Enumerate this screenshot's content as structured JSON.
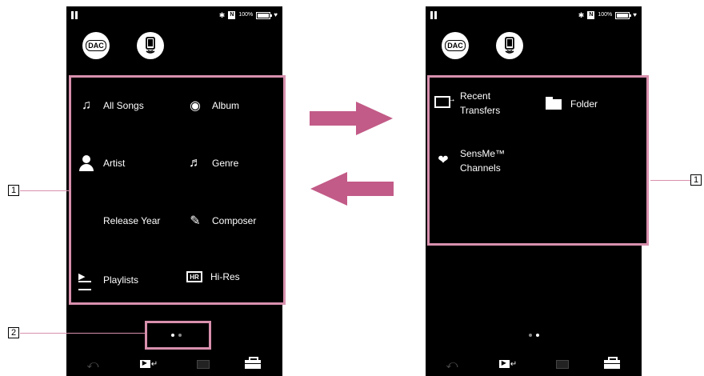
{
  "status_bar": {
    "battery_label": "100%",
    "nfc_label": "N",
    "bluetooth_glyph": "✱",
    "heart_glyph": "♥"
  },
  "dac_button": {
    "label": "DAC"
  },
  "screen_left": {
    "menu": [
      {
        "label": "All Songs",
        "icon": "music-note-icon",
        "glyph": "♫"
      },
      {
        "label": "Album",
        "icon": "disc-icon",
        "glyph": "◉"
      },
      {
        "label": "Artist",
        "icon": "artist-icon"
      },
      {
        "label": "Genre",
        "icon": "genre-icon",
        "glyph": "♬"
      },
      {
        "label": "Release Year",
        "icon": "release-year-icon"
      },
      {
        "label": "Composer",
        "icon": "composer-icon",
        "glyph": "✎"
      },
      {
        "label": "Playlists",
        "icon": "playlists-icon"
      },
      {
        "label": "Hi-Res",
        "icon": "hi-res-icon",
        "badge": "HR"
      }
    ]
  },
  "screen_right": {
    "menu": [
      {
        "label": "Recent\nTransfers",
        "icon": "recent-transfers-icon"
      },
      {
        "label": "Folder",
        "icon": "folder-icon"
      },
      {
        "label": "SensMe™\nChannels",
        "icon": "sensme-channels-icon",
        "glyph": "❤"
      }
    ]
  },
  "bottom_bar": {
    "back_glyph": "⤺",
    "nowplaying_arrow": "↵"
  },
  "callouts": {
    "one": "1",
    "two": "2"
  },
  "colors": {
    "highlight": "#d890ad",
    "arrow": "#c25b87",
    "screen_bg": "#000000"
  }
}
